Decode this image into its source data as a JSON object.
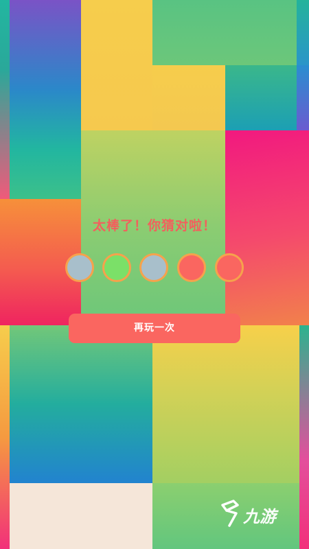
{
  "game": {
    "result_message": "太棒了！你猜对啦！",
    "replay_label": "再玩一次",
    "answer_dots": [
      {
        "color": "#a8bfcb"
      },
      {
        "color": "#7be068"
      },
      {
        "color": "#a8bfcb"
      },
      {
        "color": "#fa6660"
      },
      {
        "color": "#fa6660"
      }
    ],
    "dot_ring_color": "#f6a24c",
    "accent_color": "#fa6660"
  },
  "watermark": {
    "text": "九游",
    "icon": "jiuyou-logo-icon"
  }
}
